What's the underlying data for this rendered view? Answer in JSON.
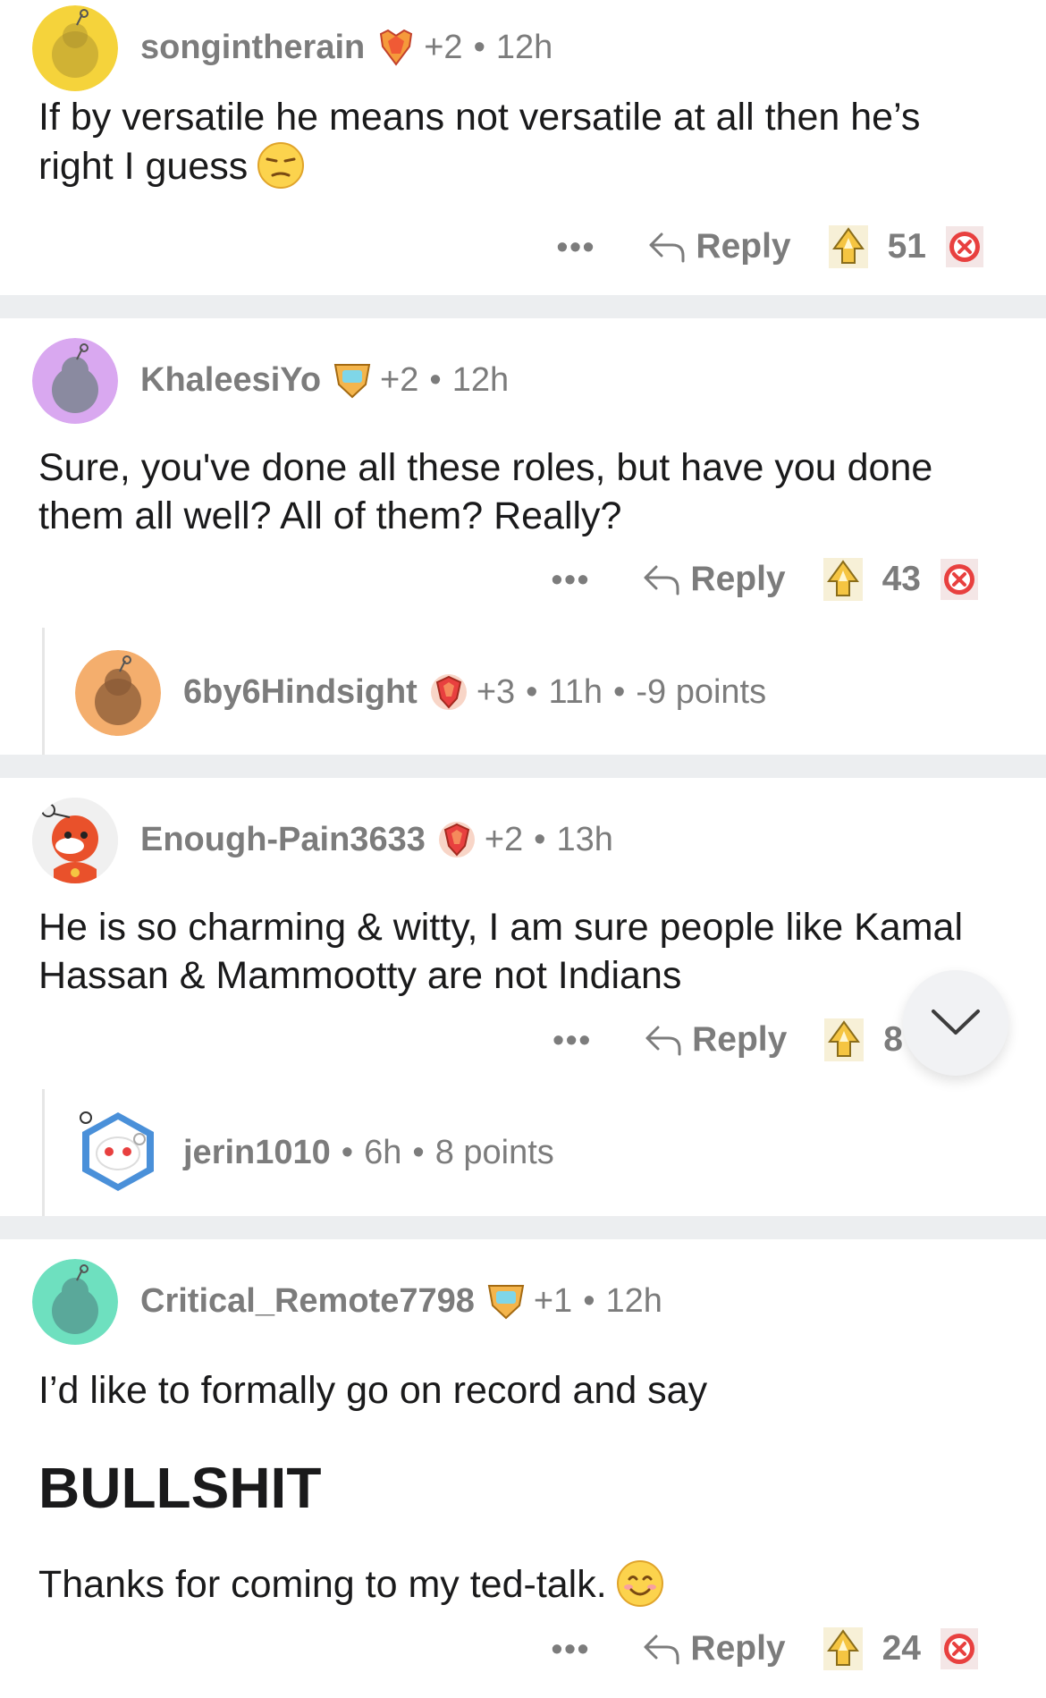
{
  "comments": [
    {
      "user": "songintherain",
      "karma": "+2",
      "time": "12h",
      "text": "If by versatile he means not versatile at all then he’s right  I guess",
      "emoji": "unamused-face",
      "more": "•••",
      "reply": "Reply",
      "votes": "51",
      "avatar_color": "#f5d33b"
    },
    {
      "user": "KhaleesiYo",
      "karma": "+2",
      "time": "12h",
      "text": "Sure, you've done all these roles, but have you done them all well? All of them? Really?",
      "more": "•••",
      "reply": "Reply",
      "votes": "43",
      "avatar_color": "#d9a8f0",
      "reply_child": {
        "user": "6by6Hindsight",
        "karma": "+3",
        "time": "11h",
        "points": "-9 points",
        "avatar_color": "#f4ae6d"
      }
    },
    {
      "user": "Enough-Pain3633",
      "karma": "+2",
      "time": "13h",
      "text": "He is so charming & witty, I am sure people like Kamal Hassan & Mammootty are not Indians",
      "more": "•••",
      "reply": "Reply",
      "votes": "8",
      "reply_child": {
        "user": "jerin1010",
        "time": "6h",
        "points": "8 points"
      }
    },
    {
      "user": "Critical_Remote7798",
      "karma": "+1",
      "time": "12h",
      "text_line1": "I’d like to formally go on record and say",
      "text_big": "BULLSHIT",
      "text_line3": "Thanks for coming to my ted-talk.",
      "emoji": "smiling-face",
      "more": "•••",
      "reply": "Reply",
      "votes": "24",
      "avatar_color": "#6ee0bf"
    }
  ],
  "icons": {
    "reply": "reply-arrow-icon",
    "upvote": "award-upvote-icon",
    "downvote": "close-x-icon",
    "collapse": "chevron-down-icon"
  },
  "colors": {
    "meta": "#7c7c7c",
    "divider": "#eceef0",
    "downvote": "#e8403f"
  }
}
